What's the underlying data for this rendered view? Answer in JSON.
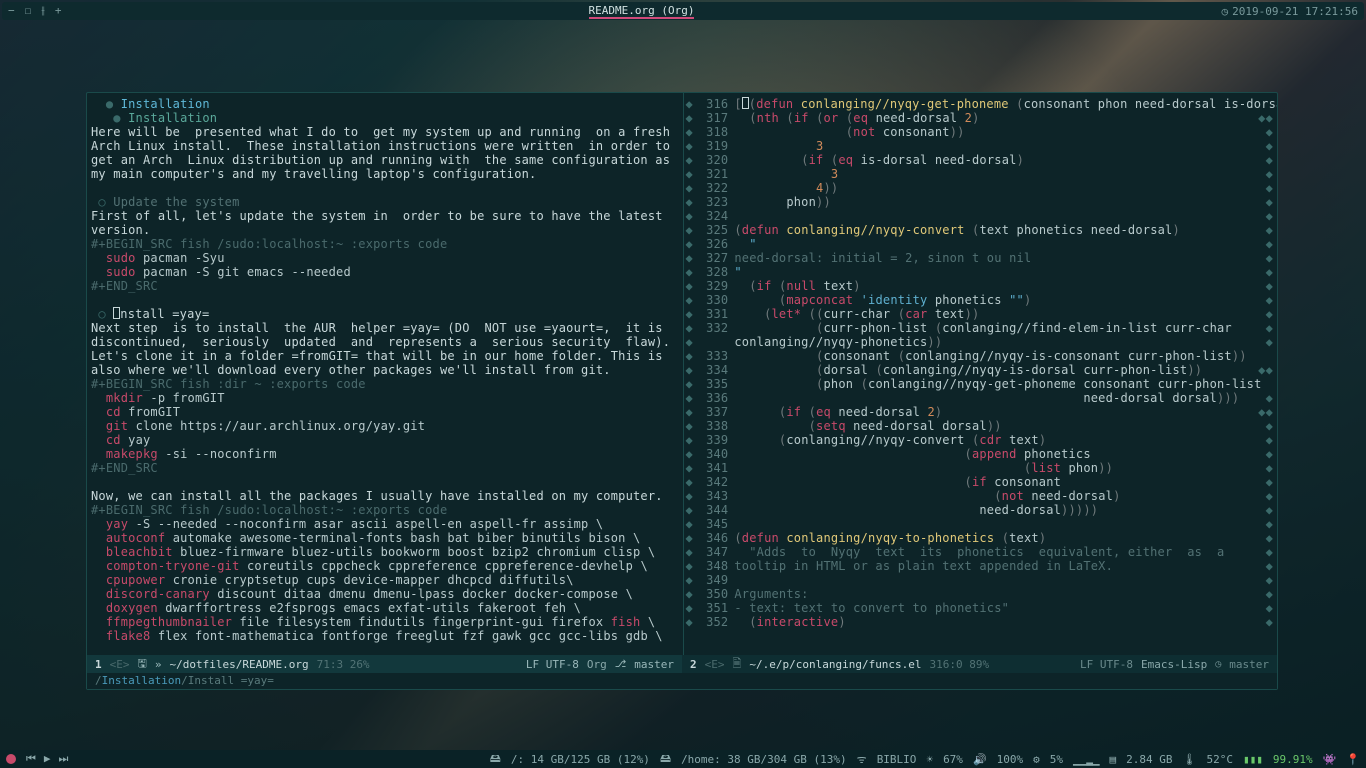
{
  "titlebar": {
    "icon_minus": "−",
    "icon_box": "☐",
    "icon_vsplit": "⫲",
    "icon_plus": "+",
    "title": "README.org (Org)",
    "clock_icon": "◷",
    "datetime": "2019-09-21 17:21:56"
  },
  "left_pane": {
    "head1": "Installation",
    "head2": "Installation",
    "para1": "Here will be  presented what I do to  get my system up and running  on a fresh\nArch Linux install.  These installation instructions were written  in order to\nget an Arch  Linux distribution up and running with  the same configuration as\nmy main computer's and my travelling laptop's configuration.",
    "subhead1": "Update the system",
    "para2": "First of all, let's update the system in  order to be sure to have the latest\nversion.",
    "src1_begin": "#+BEGIN_SRC fish /sudo:localhost:~ :exports code",
    "src1_l1a": "sudo",
    "src1_l1b": " pacman -Syu",
    "src1_l2a": "sudo",
    "src1_l2b": " pacman -S git emacs --needed",
    "src1_end": "#+END_SRC",
    "subhead2_pre": "nstall =yay=",
    "para3": "Next step  is to install  the AUR  helper =yay= (DO  NOT use =yaourt=,  it is\ndiscontinued,  seriously  updated  and  represents a  serious security  flaw).\nLet's clone it in a folder =fromGIT= that will be in our home folder. This is\nalso where we'll download every other packages we'll install from git.",
    "src2_begin": "#+BEGIN_SRC fish :dir ~ :exports code",
    "src2_l1a": "mkdir",
    "src2_l1b": " -p fromGIT",
    "src2_l2a": "cd",
    "src2_l2b": " fromGIT",
    "src2_l3a": "git",
    "src2_l3b": " clone https://aur.archlinux.org/yay.git",
    "src2_l4a": "cd",
    "src2_l4b": " yay",
    "src2_l5a": "makepkg",
    "src2_l5b": " -si --noconfirm",
    "src2_end": "#+END_SRC",
    "para4": "Now, we can install all the packages I usually have installed on my computer.",
    "src3_begin": "#+BEGIN_SRC fish /sudo:localhost:~ :exports code",
    "pkg_lines": [
      {
        "b": "yay",
        "r": " -S --needed --noconfirm asar ascii aspell-en aspell-fr assimp \\"
      },
      {
        "b": "autoconf",
        "r": " automake awesome-terminal-fonts bash bat biber binutils bison \\"
      },
      {
        "b": "bleachbit",
        "r": " bluez-firmware bluez-utils bookworm boost bzip2 chromium clisp \\"
      },
      {
        "b": "compton-tryone-git",
        "r": " coreutils cppcheck cppreference cppreference-devhelp \\"
      },
      {
        "b": "cpupower",
        "r": " cronie cryptsetup cups device-mapper dhcpcd diffutils\\"
      },
      {
        "b": "discord-canary",
        "r": " discount ditaa dmenu dmenu-lpass docker docker-compose \\"
      },
      {
        "b": "doxygen",
        "r": " dwarffortress e2fsprogs emacs exfat-utils fakeroot feh \\"
      },
      {
        "b": "ffmpegthumbnailer",
        "r": " file filesystem findutils fingerprint-gui firefox ",
        "b2": "fish",
        "r2": " \\"
      },
      {
        "b": "flake8",
        "r": " flex font-mathematica fontforge freeglut fzf gawk gcc gcc-libs gdb \\"
      }
    ]
  },
  "right_pane": {
    "lines": [
      {
        "n": 316,
        "seg": [
          {
            "c": "org-paren",
            "t": "["
          },
          {
            "c": "cursor",
            "t": ""
          },
          {
            "c": "org-paren",
            "t": "("
          },
          {
            "c": "org-kw",
            "t": "defun"
          },
          {
            "c": "",
            "t": " "
          },
          {
            "c": "org-fn",
            "t": "conlanging//nyqy-get-phoneme"
          },
          {
            "c": "",
            "t": " "
          },
          {
            "c": "org-paren",
            "t": "("
          },
          {
            "c": "",
            "t": "consonant phon need-dorsal is-dorsal"
          },
          {
            "c": "org-paren",
            "t": ")"
          }
        ]
      },
      {
        "n": 317,
        "seg": [
          {
            "c": "",
            "t": "  "
          },
          {
            "c": "org-paren",
            "t": "("
          },
          {
            "c": "org-kw",
            "t": "nth"
          },
          {
            "c": "",
            "t": " "
          },
          {
            "c": "org-paren",
            "t": "("
          },
          {
            "c": "org-kw",
            "t": "if"
          },
          {
            "c": "",
            "t": " "
          },
          {
            "c": "org-paren",
            "t": "("
          },
          {
            "c": "org-kw",
            "t": "or"
          },
          {
            "c": "",
            "t": " "
          },
          {
            "c": "org-paren",
            "t": "("
          },
          {
            "c": "org-kw",
            "t": "eq"
          },
          {
            "c": "",
            "t": " need-dorsal "
          },
          {
            "c": "org-num",
            "t": "2"
          },
          {
            "c": "org-paren",
            "t": ")"
          }
        ]
      },
      {
        "n": 318,
        "seg": [
          {
            "c": "",
            "t": "               "
          },
          {
            "c": "org-paren",
            "t": "("
          },
          {
            "c": "org-kw",
            "t": "not"
          },
          {
            "c": "",
            "t": " consonant"
          },
          {
            "c": "org-paren",
            "t": "))"
          }
        ]
      },
      {
        "n": 319,
        "seg": [
          {
            "c": "",
            "t": "           "
          },
          {
            "c": "org-num",
            "t": "3"
          }
        ]
      },
      {
        "n": 320,
        "seg": [
          {
            "c": "",
            "t": "         "
          },
          {
            "c": "org-paren",
            "t": "("
          },
          {
            "c": "org-kw",
            "t": "if"
          },
          {
            "c": "",
            "t": " "
          },
          {
            "c": "org-paren",
            "t": "("
          },
          {
            "c": "org-kw",
            "t": "eq"
          },
          {
            "c": "",
            "t": " is-dorsal need-dorsal"
          },
          {
            "c": "org-paren",
            "t": ")"
          }
        ]
      },
      {
        "n": 321,
        "seg": [
          {
            "c": "",
            "t": "             "
          },
          {
            "c": "org-num",
            "t": "3"
          }
        ]
      },
      {
        "n": 322,
        "seg": [
          {
            "c": "",
            "t": "           "
          },
          {
            "c": "org-num",
            "t": "4"
          },
          {
            "c": "org-paren",
            "t": "))"
          }
        ]
      },
      {
        "n": 323,
        "seg": [
          {
            "c": "",
            "t": "       phon"
          },
          {
            "c": "org-paren",
            "t": "))"
          }
        ]
      },
      {
        "n": 324,
        "seg": []
      },
      {
        "n": 325,
        "seg": [
          {
            "c": "org-paren",
            "t": "("
          },
          {
            "c": "org-kw",
            "t": "defun"
          },
          {
            "c": "",
            "t": " "
          },
          {
            "c": "org-fn",
            "t": "conlanging//nyqy-convert"
          },
          {
            "c": "",
            "t": " "
          },
          {
            "c": "org-paren",
            "t": "("
          },
          {
            "c": "",
            "t": "text phonetics need-dorsal"
          },
          {
            "c": "org-paren",
            "t": ")"
          }
        ]
      },
      {
        "n": 326,
        "seg": [
          {
            "c": "org-str",
            "t": "  \""
          }
        ]
      },
      {
        "n": 327,
        "seg": [
          {
            "c": "org-dim",
            "t": "need-dorsal: initial = 2, sinon t ou nil"
          }
        ]
      },
      {
        "n": 328,
        "seg": [
          {
            "c": "org-str",
            "t": "\""
          }
        ]
      },
      {
        "n": 329,
        "seg": [
          {
            "c": "",
            "t": "  "
          },
          {
            "c": "org-paren",
            "t": "("
          },
          {
            "c": "org-kw",
            "t": "if"
          },
          {
            "c": "",
            "t": " "
          },
          {
            "c": "org-paren",
            "t": "("
          },
          {
            "c": "org-kw",
            "t": "null"
          },
          {
            "c": "",
            "t": " text"
          },
          {
            "c": "org-paren",
            "t": ")"
          }
        ]
      },
      {
        "n": 330,
        "seg": [
          {
            "c": "",
            "t": "      "
          },
          {
            "c": "org-paren",
            "t": "("
          },
          {
            "c": "org-kw",
            "t": "mapconcat"
          },
          {
            "c": "",
            "t": " "
          },
          {
            "c": "org-str",
            "t": "'identity"
          },
          {
            "c": "",
            "t": " phonetics "
          },
          {
            "c": "org-str",
            "t": "\"\""
          },
          {
            "c": "org-paren",
            "t": ")"
          }
        ]
      },
      {
        "n": 331,
        "seg": [
          {
            "c": "",
            "t": "    "
          },
          {
            "c": "org-paren",
            "t": "("
          },
          {
            "c": "org-kw",
            "t": "let*"
          },
          {
            "c": "",
            "t": " "
          },
          {
            "c": "org-paren",
            "t": "(("
          },
          {
            "c": "",
            "t": "curr-char "
          },
          {
            "c": "org-paren",
            "t": "("
          },
          {
            "c": "org-kw",
            "t": "car"
          },
          {
            "c": "",
            "t": " text"
          },
          {
            "c": "org-paren",
            "t": "))"
          }
        ]
      },
      {
        "n": 332,
        "seg": [
          {
            "c": "",
            "t": "           "
          },
          {
            "c": "org-paren",
            "t": "("
          },
          {
            "c": "",
            "t": "curr-phon-list "
          },
          {
            "c": "org-paren",
            "t": "("
          },
          {
            "c": "",
            "t": "conlanging//find-elem-in-list curr-char"
          }
        ]
      },
      {
        "n": 0,
        "cont": true,
        "seg": [
          {
            "c": "",
            "t": "conlanging//nyqy-phonetics"
          },
          {
            "c": "org-paren",
            "t": "))"
          }
        ]
      },
      {
        "n": 333,
        "seg": [
          {
            "c": "",
            "t": "           "
          },
          {
            "c": "org-paren",
            "t": "("
          },
          {
            "c": "",
            "t": "consonant "
          },
          {
            "c": "org-paren",
            "t": "("
          },
          {
            "c": "",
            "t": "conlanging//nyqy-is-consonant curr-phon-list"
          },
          {
            "c": "org-paren",
            "t": "))"
          }
        ]
      },
      {
        "n": 334,
        "seg": [
          {
            "c": "",
            "t": "           "
          },
          {
            "c": "org-paren",
            "t": "("
          },
          {
            "c": "",
            "t": "dorsal "
          },
          {
            "c": "org-paren",
            "t": "("
          },
          {
            "c": "",
            "t": "conlanging//nyqy-is-dorsal curr-phon-list"
          },
          {
            "c": "org-paren",
            "t": "))"
          }
        ]
      },
      {
        "n": 335,
        "seg": [
          {
            "c": "",
            "t": "           "
          },
          {
            "c": "org-paren",
            "t": "("
          },
          {
            "c": "",
            "t": "phon "
          },
          {
            "c": "org-paren",
            "t": "("
          },
          {
            "c": "",
            "t": "conlanging//nyqy-get-phoneme consonant curr-phon-list"
          }
        ]
      },
      {
        "n": 336,
        "seg": [
          {
            "c": "",
            "t": "                                               need-dorsal dorsal"
          },
          {
            "c": "org-paren",
            "t": ")))"
          }
        ]
      },
      {
        "n": 337,
        "seg": [
          {
            "c": "",
            "t": "      "
          },
          {
            "c": "org-paren",
            "t": "("
          },
          {
            "c": "org-kw",
            "t": "if"
          },
          {
            "c": "",
            "t": " "
          },
          {
            "c": "org-paren",
            "t": "("
          },
          {
            "c": "org-kw",
            "t": "eq"
          },
          {
            "c": "",
            "t": " need-dorsal "
          },
          {
            "c": "org-num",
            "t": "2"
          },
          {
            "c": "org-paren",
            "t": ")"
          }
        ]
      },
      {
        "n": 338,
        "seg": [
          {
            "c": "",
            "t": "          "
          },
          {
            "c": "org-paren",
            "t": "("
          },
          {
            "c": "org-kw",
            "t": "setq"
          },
          {
            "c": "",
            "t": " need-dorsal dorsal"
          },
          {
            "c": "org-paren",
            "t": "))"
          }
        ]
      },
      {
        "n": 339,
        "seg": [
          {
            "c": "",
            "t": "      "
          },
          {
            "c": "org-paren",
            "t": "("
          },
          {
            "c": "",
            "t": "conlanging//nyqy-convert "
          },
          {
            "c": "org-paren",
            "t": "("
          },
          {
            "c": "org-kw",
            "t": "cdr"
          },
          {
            "c": "",
            "t": " text"
          },
          {
            "c": "org-paren",
            "t": ")"
          }
        ]
      },
      {
        "n": 340,
        "seg": [
          {
            "c": "",
            "t": "                               "
          },
          {
            "c": "org-paren",
            "t": "("
          },
          {
            "c": "org-kw",
            "t": "append"
          },
          {
            "c": "",
            "t": " phonetics"
          }
        ]
      },
      {
        "n": 341,
        "seg": [
          {
            "c": "",
            "t": "                                       "
          },
          {
            "c": "org-paren",
            "t": "("
          },
          {
            "c": "org-kw",
            "t": "list"
          },
          {
            "c": "",
            "t": " phon"
          },
          {
            "c": "org-paren",
            "t": "))"
          }
        ]
      },
      {
        "n": 342,
        "seg": [
          {
            "c": "",
            "t": "                               "
          },
          {
            "c": "org-paren",
            "t": "("
          },
          {
            "c": "org-kw",
            "t": "if"
          },
          {
            "c": "",
            "t": " consonant"
          }
        ]
      },
      {
        "n": 343,
        "seg": [
          {
            "c": "",
            "t": "                                   "
          },
          {
            "c": "org-paren",
            "t": "("
          },
          {
            "c": "org-kw",
            "t": "not"
          },
          {
            "c": "",
            "t": " need-dorsal"
          },
          {
            "c": "org-paren",
            "t": ")"
          }
        ]
      },
      {
        "n": 344,
        "seg": [
          {
            "c": "",
            "t": "                                 need-dorsal"
          },
          {
            "c": "org-paren",
            "t": ")))))"
          }
        ]
      },
      {
        "n": 345,
        "seg": []
      },
      {
        "n": 346,
        "seg": [
          {
            "c": "org-paren",
            "t": "("
          },
          {
            "c": "org-kw",
            "t": "defun"
          },
          {
            "c": "",
            "t": " "
          },
          {
            "c": "org-fn",
            "t": "conlanging/nyqy-to-phonetics"
          },
          {
            "c": "",
            "t": " "
          },
          {
            "c": "org-paren",
            "t": "("
          },
          {
            "c": "",
            "t": "text"
          },
          {
            "c": "org-paren",
            "t": ")"
          }
        ]
      },
      {
        "n": 347,
        "seg": [
          {
            "c": "org-dim",
            "t": "  \"Adds  to  Nyqy  text  its  phonetics  equivalent, either  as  a"
          }
        ]
      },
      {
        "n": 348,
        "seg": [
          {
            "c": "org-dim",
            "t": "tooltip in HTML or as plain text appended in LaTeX."
          }
        ]
      },
      {
        "n": 349,
        "seg": []
      },
      {
        "n": 350,
        "seg": [
          {
            "c": "org-dim",
            "t": "Arguments:"
          }
        ]
      },
      {
        "n": 351,
        "seg": [
          {
            "c": "org-dim",
            "t": "- text: text to convert to phonetics\""
          }
        ]
      },
      {
        "n": 352,
        "seg": [
          {
            "c": "",
            "t": "  "
          },
          {
            "c": "org-paren",
            "t": "("
          },
          {
            "c": "org-kw",
            "t": "interactive"
          },
          {
            "c": "org-paren",
            "t": ")"
          }
        ]
      }
    ]
  },
  "modeline_left": {
    "pos": "1",
    "evil": "<E>",
    "icon": "🖫",
    "path": "~/dotfiles/README.org",
    "pct": "71:3 26%",
    "encoding": "LF UTF-8",
    "mode": "Org",
    "git_icon": "⎇",
    "branch": "master"
  },
  "modeline_right": {
    "pos": "2",
    "evil": "<E>",
    "icon": "🗎",
    "path": "~/.e/p/conlanging/funcs.el",
    "pct": "316:0 89%",
    "encoding": "LF UTF-8",
    "mode": "Emacs-Lisp",
    "git_icon": "◷",
    "branch": "master"
  },
  "breadcrumb": {
    "slash": "/",
    "c1": "Installation",
    "c2": "Install =yay="
  },
  "bottombar": {
    "disk1_icon": "🖴",
    "disk1": "/: 14 GB/125 GB (12%)",
    "disk2_icon": "🖴",
    "disk2": "/home: 38 GB/304 GB (13%)",
    "wifi_icon": "ᯤ",
    "wifi": "BIBLIO",
    "bright_icon": "☀",
    "bright": "67%",
    "vol_icon": "🔊",
    "vol": "100%",
    "cpu_icon": "⚙",
    "cpu": "5%",
    "cpu_bars": "▁▁▂▁",
    "ram_icon": "▤",
    "ram": "2.84 GB",
    "temp_icon": "🌡",
    "temp": "52°C",
    "bat_icon": "▮▮▮",
    "bat": "99.91%",
    "discord_icon": "👾",
    "pin_icon": "📍",
    "play_prev": "⏮",
    "play_play": "▶",
    "play_next": "⏭"
  }
}
